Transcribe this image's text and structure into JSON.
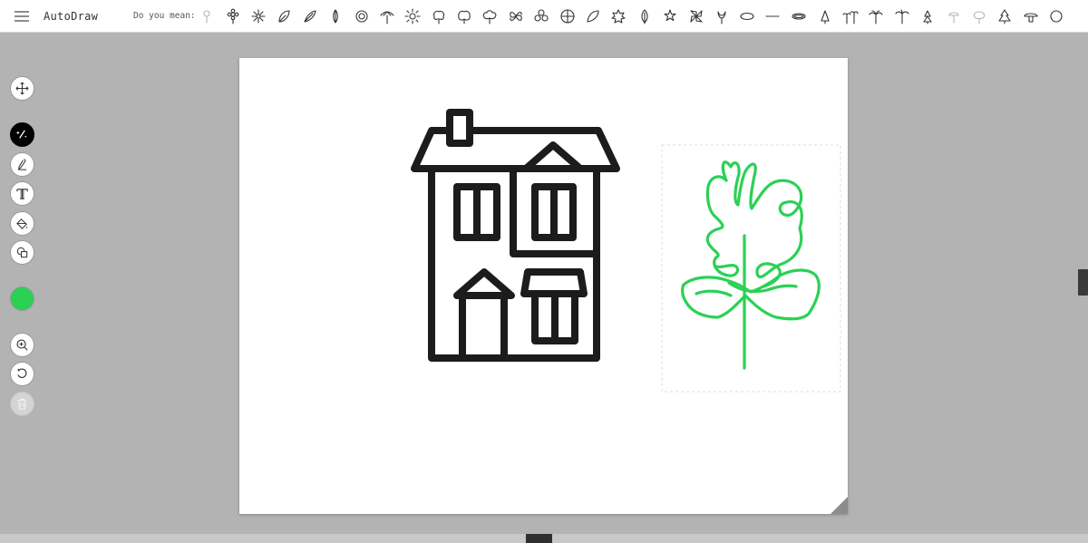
{
  "app": {
    "title": "AutoDraw"
  },
  "suggestions": {
    "label": "Do you mean:",
    "items": [
      "flower-small-icon",
      "flower-daisy-icon",
      "flower-round-icon",
      "flower-petal-icon",
      "leaf-feather-icon",
      "leaf-long-icon",
      "feather-thin-icon",
      "sunflower-icon",
      "palm-fan-icon",
      "flower-burst-icon",
      "tree-round-icon",
      "cloud-tree-icon",
      "bush-icon",
      "butterfly-petal-icon",
      "clover-icon",
      "globe-quarter-icon",
      "leaf-simple-icon",
      "maple-leaf-icon",
      "leaf-pointed-icon",
      "star-flower-icon",
      "pinwheel-icon",
      "tulip-icon",
      "ellipse-icon",
      "dotted-line-icon",
      "oval-ring-icon",
      "cone-icon",
      "palm-trees-icon",
      "palm-tree-icon",
      "palm-single-icon",
      "pine-light-icon",
      "mushroom-light-icon",
      "tree-outline-icon",
      "christmas-tree-icon",
      "mushroom-icon"
    ]
  },
  "tools": [
    {
      "name": "move-tool",
      "icon": "move-icon"
    },
    {
      "name": "autodraw-tool",
      "icon": "autodraw-sparkle-icon",
      "active": true
    },
    {
      "name": "draw-tool",
      "icon": "pencil-icon"
    },
    {
      "name": "type-tool",
      "icon": "type-icon"
    },
    {
      "name": "fill-tool",
      "icon": "paint-bucket-icon"
    },
    {
      "name": "shape-tool",
      "icon": "shapes-icon"
    }
  ],
  "color": {
    "selected": "#2ad155"
  },
  "actions": [
    {
      "name": "zoom-tool",
      "icon": "zoom-in-icon"
    },
    {
      "name": "undo-button",
      "icon": "undo-icon"
    },
    {
      "name": "delete-button",
      "icon": "trash-icon",
      "disabled": true
    }
  ],
  "canvas": {
    "drawings": [
      {
        "name": "house-drawing",
        "color": "#1c1c1c"
      },
      {
        "name": "tree-sketch",
        "color": "#2ad155"
      }
    ]
  }
}
